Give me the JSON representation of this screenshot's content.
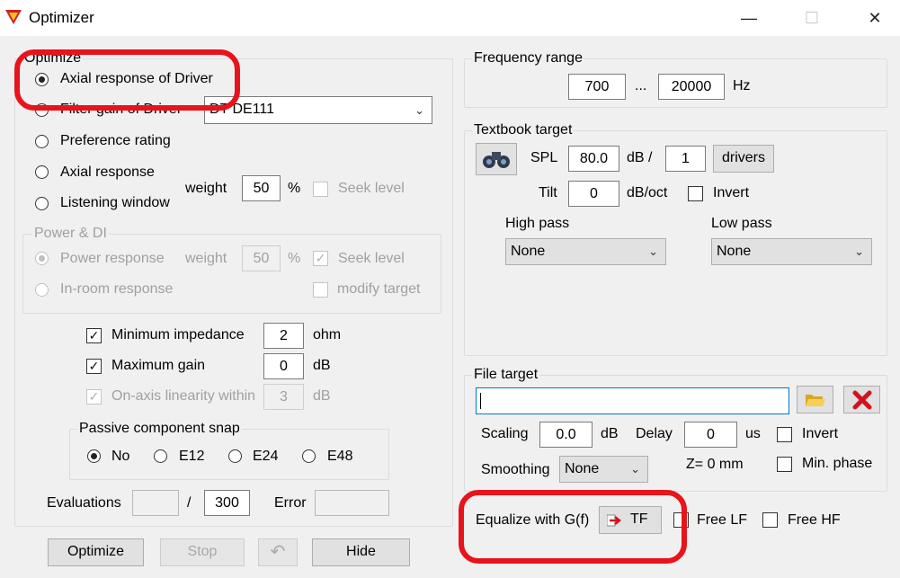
{
  "window": {
    "title": "Optimizer",
    "minimize_glyph": "—",
    "maximize_glyph": "☐",
    "close_glyph": "✕"
  },
  "optimize": {
    "legend": "Optimize",
    "axial_driver": "Axial response of Driver",
    "filter_gain": "Filter gain of Driver",
    "driver_select": "DT DE111",
    "preference": "Preference rating",
    "axial": "Axial response",
    "listening": "Listening window",
    "weight_label": "weight",
    "weight_value": "50",
    "percent": "%",
    "seek_level": "Seek level"
  },
  "power_di": {
    "legend": "Power & DI",
    "power_response": "Power response",
    "in_room": "In-room response",
    "weight_label": "weight",
    "weight_value": "50",
    "percent": "%",
    "seek_level": "Seek level",
    "modify_target": "modify target"
  },
  "constraints": {
    "min_impedance": "Minimum impedance",
    "min_impedance_value": "2",
    "min_impedance_unit": "ohm",
    "max_gain": "Maximum gain",
    "max_gain_value": "0",
    "max_gain_unit": "dB",
    "linearity": "On-axis linearity within",
    "linearity_value": "3",
    "linearity_unit": "dB"
  },
  "snap": {
    "legend": "Passive component snap",
    "no": "No",
    "e12": "E12",
    "e24": "E24",
    "e48": "E48"
  },
  "evaluations": {
    "label": "Evaluations",
    "current": "",
    "slash": "/",
    "max": "300",
    "error_label": "Error",
    "error_value": ""
  },
  "buttons": {
    "optimize": "Optimize",
    "stop": "Stop",
    "undo_glyph": "↶",
    "hide": "Hide"
  },
  "frequency": {
    "legend": "Frequency range",
    "low": "700",
    "dots": "...",
    "high": "20000",
    "unit": "Hz"
  },
  "textbook": {
    "legend": "Textbook target",
    "spl_label": "SPL",
    "spl_value": "80.0",
    "db_per": "dB /",
    "drivers_value": "1",
    "drivers_button": "drivers",
    "tilt_label": "Tilt",
    "tilt_value": "0",
    "tilt_unit": "dB/oct",
    "invert": "Invert",
    "high_pass_label": "High pass",
    "high_pass_value": "None",
    "low_pass_label": "Low pass",
    "low_pass_value": "None"
  },
  "file_target": {
    "legend": "File target",
    "path": "",
    "scaling_label": "Scaling",
    "scaling_value": "0.0",
    "scaling_unit": "dB",
    "delay_label": "Delay",
    "delay_value": "0",
    "delay_unit": "us",
    "invert": "Invert",
    "smoothing_label": "Smoothing",
    "smoothing_value": "None",
    "z_text": "Z= 0 mm",
    "min_phase": "Min. phase"
  },
  "equalize": {
    "label": "Equalize with G(f)",
    "tf_button": "TF",
    "free_lf": "Free LF",
    "free_hf": "Free HF"
  },
  "colors": {
    "highlight": "#e8131b",
    "background": "#f0f0f0"
  }
}
